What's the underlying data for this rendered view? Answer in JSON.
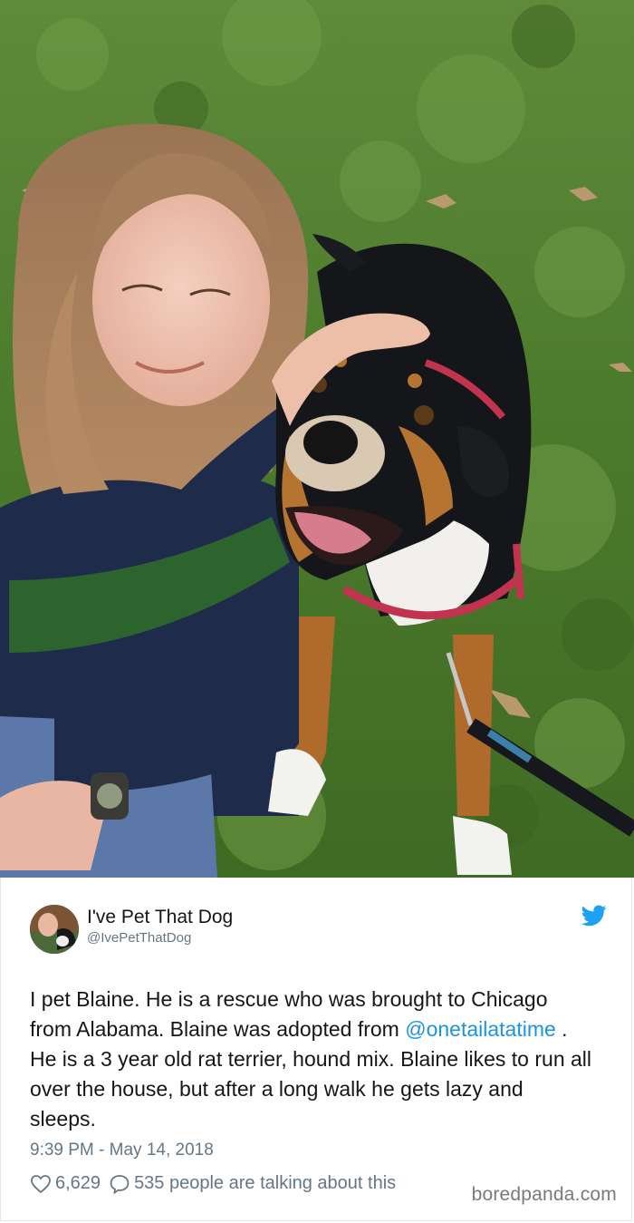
{
  "tweet": {
    "display_name": "I've Pet That Dog",
    "handle": "@IvePetThatDog",
    "text_before_mention": "I pet Blaine. He is a rescue who was brought to Chicago from Alabama. Blaine was adopted from ",
    "mention": "@onetailatatime",
    "text_after_mention": " . He is a 3 year old rat terrier, hound mix. Blaine likes to run all over the house, but after a long walk he gets lazy and sleeps.",
    "timestamp": "9:39 PM - May 14, 2018",
    "likes": "6,629",
    "replies_text": "535 people are talking about this"
  },
  "watermark": "boredpanda.com",
  "icons": {
    "brand": "twitter-bird-icon",
    "like": "heart-icon",
    "reply": "speech-bubble-icon"
  },
  "colors": {
    "link": "#1b95e0",
    "twitter_blue": "#1da1f2",
    "muted": "#657786",
    "text": "#14171a",
    "grass": "#4a7a2c"
  }
}
